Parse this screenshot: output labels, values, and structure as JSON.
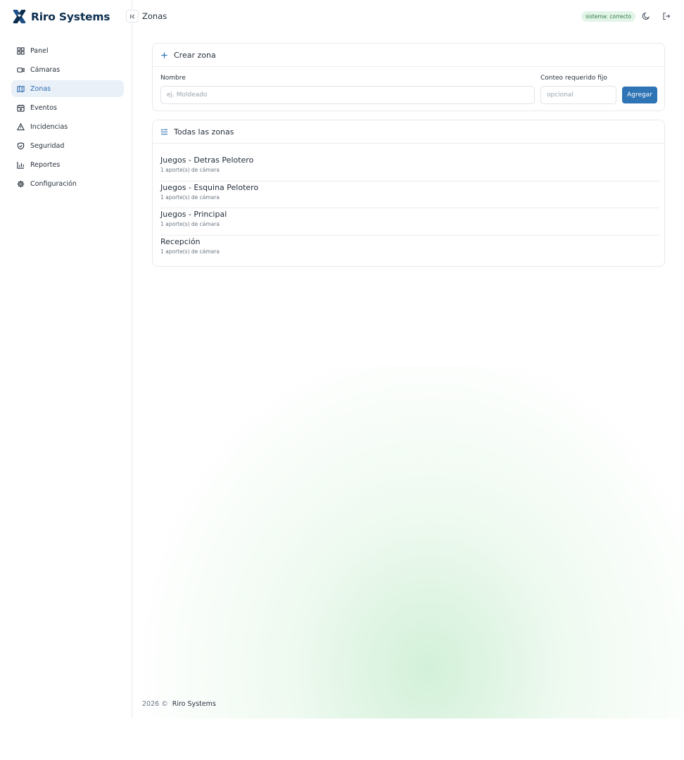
{
  "brand": {
    "name": "Riro Systems",
    "logo_icon": "riro-logo-icon",
    "color": "#0d2f4f"
  },
  "header": {
    "collapse_icon": "collapse-sidebar-icon",
    "title": "Zonas",
    "status_badge": "sistema: correcto",
    "theme_icon": "moon-icon",
    "logout_icon": "logout-icon"
  },
  "sidebar": {
    "items": [
      {
        "label": "Panel",
        "icon": "dashboard-grid-icon",
        "active": false
      },
      {
        "label": "Cámaras",
        "icon": "video-camera-icon",
        "active": false
      },
      {
        "label": "Zonas",
        "icon": "map-icon",
        "active": true
      },
      {
        "label": "Eventos",
        "icon": "calendar-icon",
        "active": false
      },
      {
        "label": "Incidencias",
        "icon": "warning-triangle-icon",
        "active": false
      },
      {
        "label": "Seguridad",
        "icon": "shield-check-icon",
        "active": false
      },
      {
        "label": "Reportes",
        "icon": "bar-chart-icon",
        "active": false
      },
      {
        "label": "Configuración",
        "icon": "gear-icon",
        "active": false
      }
    ]
  },
  "create_zone": {
    "title": "Crear zona",
    "icon": "plus-icon",
    "name_label": "Nombre",
    "name_placeholder": "ej. Moldeado",
    "count_label": "Conteo requerido fijo",
    "count_placeholder": "opcional",
    "add_button": "Agregar"
  },
  "all_zones": {
    "title": "Todas las zonas",
    "icon": "list-icon",
    "zones": [
      {
        "name": "Juegos - Detras Pelotero",
        "meta": "1 aporte(s) de cámara"
      },
      {
        "name": "Juegos - Esquina Pelotero",
        "meta": "1 aporte(s) de cámara"
      },
      {
        "name": "Juegos - Principal",
        "meta": "1 aporte(s) de cámara"
      },
      {
        "name": "Recepción",
        "meta": "1 aporte(s) de cámara"
      }
    ]
  },
  "footer": {
    "year": "2026 ©",
    "brand": "Riro Systems"
  },
  "colors": {
    "accent": "#2f74b5",
    "status_bg": "#e3f4e8",
    "status_text": "#2b7a45",
    "active_nav_bg": "#eaf0f7"
  }
}
